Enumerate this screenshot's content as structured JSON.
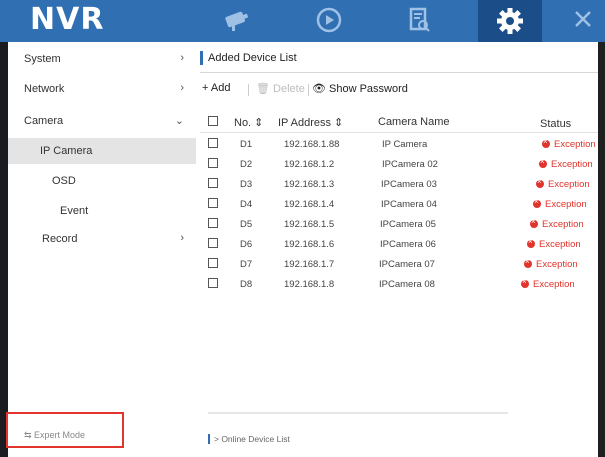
{
  "brand": {
    "logo": "NVR"
  },
  "topnav": {
    "icons": [
      "camera-icon",
      "playback-icon",
      "search-icon",
      "settings-icon",
      "close-icon"
    ],
    "active": "settings-icon",
    "colors": {
      "bar": "#2f6fb2",
      "active": "#1b4e88"
    }
  },
  "sidebar": {
    "items": [
      {
        "label": "System",
        "arrow": "›"
      },
      {
        "label": "Network",
        "arrow": "›"
      },
      {
        "label": "Camera",
        "arrow": "⌄"
      },
      {
        "label": "IP Camera"
      },
      {
        "label": "OSD"
      },
      {
        "label": "Event"
      },
      {
        "label": "Record",
        "arrow": "›"
      }
    ],
    "expert_mode": "⇆ Expert Mode"
  },
  "main": {
    "section_title": "Added Device List",
    "toolbar": {
      "add": "+ Add",
      "delete": "🗑 Delete",
      "show_password": "👁 Show Password"
    },
    "columns": {
      "no": "No. ⇕",
      "ip": "IP Address ⇕",
      "name": "Camera Name",
      "status": "Status"
    },
    "rows": [
      {
        "no": "D1",
        "ip": "192.168.1.88",
        "name": "IP Camera",
        "status": "Exception"
      },
      {
        "no": "D2",
        "ip": "192.168.1.2",
        "name": "IPCamera 02",
        "status": "Exception"
      },
      {
        "no": "D3",
        "ip": "192.168.1.3",
        "name": "IPCamera 03",
        "status": "Exception"
      },
      {
        "no": "D4",
        "ip": "192.168.1.4",
        "name": "IPCamera 04",
        "status": "Exception"
      },
      {
        "no": "D5",
        "ip": "192.168.1.5",
        "name": "IPCamera 05",
        "status": "Exception"
      },
      {
        "no": "D6",
        "ip": "192.168.1.6",
        "name": "IPCamera 06",
        "status": "Exception"
      },
      {
        "no": "D7",
        "ip": "192.168.1.7",
        "name": "IPCamera 07",
        "status": "Exception"
      },
      {
        "no": "D8",
        "ip": "192.168.1.8",
        "name": "IPCamera 08",
        "status": "Exception"
      }
    ],
    "online_list": "> Online Device List",
    "status_color": "#e0342c"
  }
}
